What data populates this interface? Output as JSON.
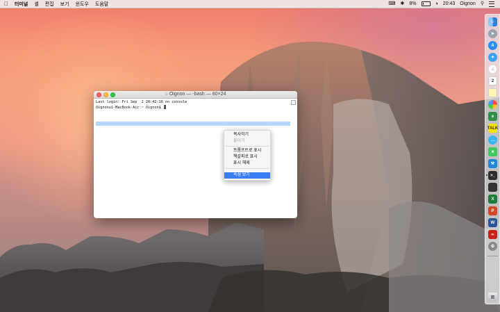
{
  "menubar": {
    "app_name": "터미널",
    "items": [
      "셸",
      "편집",
      "보기",
      "윈도우",
      "도움말"
    ],
    "battery": "8%",
    "clock": "20:43",
    "user": "Oignon"
  },
  "terminal": {
    "title": "Oignon — -bash — 80×24",
    "lines": [
      "Last login: Fri Sep  2 20:42:16 on console",
      "Oignonui-MacBook-Air:~ Oignon$ "
    ]
  },
  "context_menu": {
    "items": [
      {
        "label": "복사하기",
        "enabled": true
      },
      {
        "label": "붙이기",
        "enabled": false
      },
      {
        "label": "프롬프트로 표시",
        "enabled": true
      },
      {
        "label": "책갈피로 표시",
        "enabled": true
      },
      {
        "label": "표시 해제",
        "enabled": true
      },
      {
        "label": "속성 보기",
        "enabled": true,
        "highlighted": true
      }
    ]
  },
  "dock": {
    "icons": [
      "finder-icon",
      "launchpad-icon",
      "appstore-icon",
      "safari-icon",
      "itunes-icon",
      "calendar-icon",
      "notes-icon",
      "photos-icon",
      "evernote-icon",
      "kakaotalk-icon",
      "messages-icon",
      "facetime-icon",
      "xcode-icon",
      "terminal-icon",
      "activity-icon",
      "excel-icon",
      "powerpoint-icon",
      "word-icon",
      "acrobat-icon",
      "system-preferences-icon",
      "trash-icon"
    ],
    "calendar_day": "2"
  },
  "colors": {
    "menu_highlight": "#3a7ef3",
    "selection": "#b5d5fb",
    "close": "#fc605c",
    "minimize": "#fdbc40",
    "zoom": "#34c84a"
  }
}
